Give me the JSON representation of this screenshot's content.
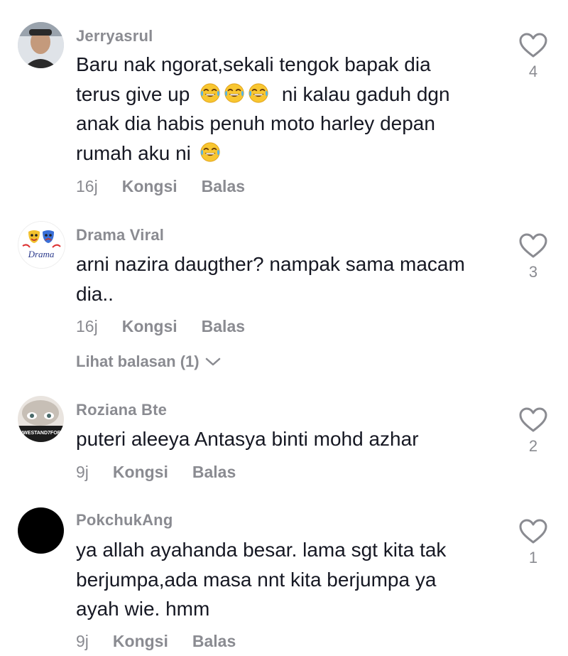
{
  "comments": [
    {
      "username": "Jerryasrul",
      "lines": [
        "Baru nak ngorat,sekali tengok bapak dia",
        "terus give up",
        "ni kalau gaduh dgn",
        "anak dia habis penuh moto harley depan",
        "rumah aku ni"
      ],
      "time": "16j",
      "share": "Kongsi",
      "reply": "Balas",
      "likes": "4",
      "emoji_name": "face-with-tears-of-joy"
    },
    {
      "username": "Drama Viral",
      "avatar_text": "Drama",
      "lines": [
        "arni nazira daugther? nampak sama macam",
        "dia.."
      ],
      "time": "16j",
      "share": "Kongsi",
      "reply": "Balas",
      "likes": "3",
      "view_replies": "Lihat balasan (1)"
    },
    {
      "username": "Roziana Bte",
      "avatar_text": "#WESTAND7FOR",
      "lines": [
        "puteri aleeya Antasya binti mohd azhar"
      ],
      "time": "9j",
      "share": "Kongsi",
      "reply": "Balas",
      "likes": "2"
    },
    {
      "username": "PokchukAng",
      "lines": [
        "ya allah ayahanda besar. lama sgt kita tak",
        "berjumpa,ada masa nnt kita berjumpa ya",
        "ayah wie. hmm"
      ],
      "time": "9j",
      "share": "Kongsi",
      "reply": "Balas",
      "likes": "1"
    }
  ],
  "colors": {
    "text": "#161823",
    "muted": "#8a8b91",
    "background": "#ffffff"
  }
}
